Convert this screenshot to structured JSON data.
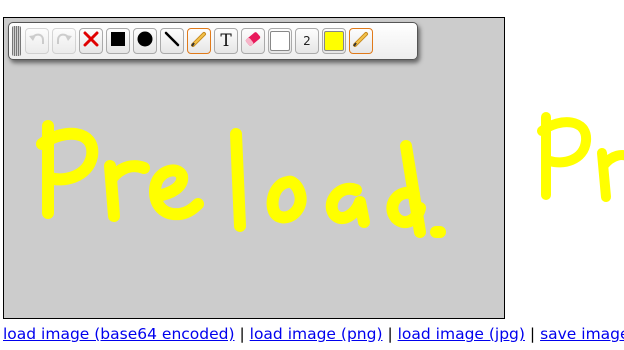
{
  "canvas": {
    "background": "#cccccc",
    "drawing": {
      "text": "Preload.",
      "color": "#ffff00"
    }
  },
  "toolbar": {
    "undo_icon": "undo-arrow-icon",
    "redo_icon": "redo-arrow-icon",
    "clear_icon": "red-x-icon",
    "square_icon": "square-icon",
    "circle_icon": "circle-icon",
    "line_icon": "line-icon",
    "pencil_icon": "pencil-icon",
    "text_label": "T",
    "eraser_icon": "eraser-icon",
    "stroke_color": "#ffffff",
    "size_label": "2",
    "fill_color": "#ffff00",
    "pencil2_icon": "pencil-icon"
  },
  "links": {
    "load_base64": "load image (base64 encoded)",
    "load_png": "load image (png)",
    "load_jpg": "load image (jpg)",
    "save": "save image",
    "separator": "|"
  }
}
